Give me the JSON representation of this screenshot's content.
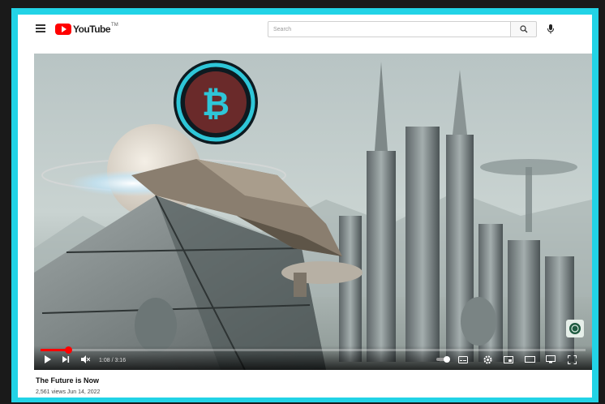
{
  "masthead": {
    "logo_text": "YouTube",
    "logo_superscript": "TM",
    "search_placeholder": "Search",
    "menu_icon": "hamburger-menu-icon",
    "search_icon": "search-icon",
    "mic_icon": "microphone-icon"
  },
  "player": {
    "time": "1:08 / 3:16",
    "progress_fraction": 0.05,
    "controls": [
      "play-icon",
      "next-icon",
      "mute-icon",
      "autoplay-toggle",
      "subtitles-icon",
      "settings-icon",
      "miniplayer-icon",
      "theater-icon",
      "cast-icon",
      "fullscreen-icon"
    ]
  },
  "video": {
    "title": "The Future is Now",
    "meta": "2,561 views  Jun 14, 2022"
  },
  "colors": {
    "border": "#22d3e6",
    "brand_red": "#ff0000"
  }
}
